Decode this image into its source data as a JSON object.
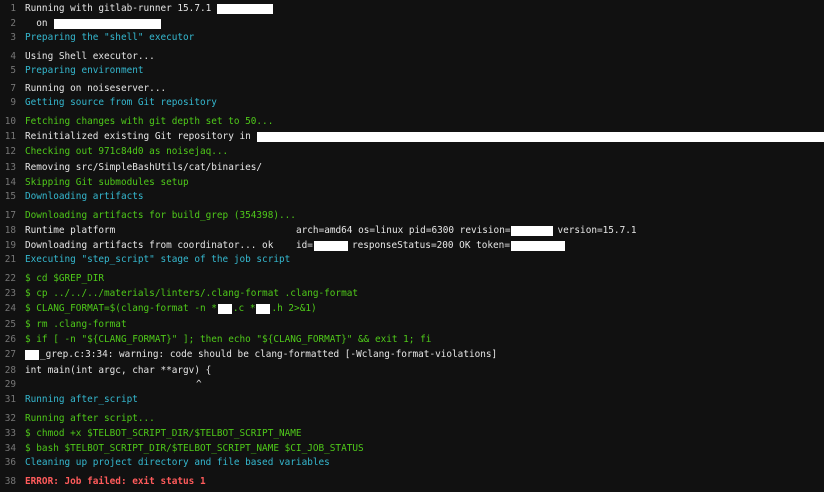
{
  "colors": {
    "background": "#111111",
    "line_number": "#777777",
    "text": "#e6e6e6",
    "section": "#35b8cf",
    "command": "#4fc91a",
    "error": "#ff5b5b",
    "redaction": "#ffffff"
  },
  "log": {
    "l1": "Running with gitlab-runner 15.7.1",
    "l2": "  on",
    "l3": "Preparing the \"shell\" executor",
    "l4": "Using Shell executor...",
    "l5": "Preparing environment",
    "l7": "Running on noiseserver...",
    "l9": "Getting source from Git repository",
    "l10": "Fetching changes with git depth set to 50...",
    "l11": "Reinitialized existing Git repository in",
    "l12": "Checking out 971c84d0 as noisejaq...",
    "l13": "Removing src/SimpleBashUtils/cat/binaries/",
    "l14": "Skipping Git submodules setup",
    "l15": "Downloading artifacts",
    "l17": "Downloading artifacts for build_grep (354398)...",
    "l18a": "Runtime platform",
    "l18b": "arch=amd64 os=linux pid=6300 revision=",
    "l18c": "version=15.7.1",
    "l19a": "Downloading artifacts from coordinator... ok",
    "l19b": "id=",
    "l19c": "responseStatus=200 OK token=",
    "l21": "Executing \"step_script\" stage of the job script",
    "l22": "$ cd $GREP_DIR",
    "l23": "$ cp ../../../materials/linters/.clang-format .clang-format",
    "l24a": "$ CLANG_FORMAT=$(clang-format -n *",
    "l24b": ".c *",
    "l24c": ".h 2>&1)",
    "l25": "$ rm .clang-format",
    "l26": "$ if [ -n \"${CLANG_FORMAT}\" ]; then echo \"${CLANG_FORMAT}\" && exit 1; fi",
    "l27": "_grep.c:3:34: warning: code should be clang-formatted [-Wclang-format-violations]",
    "l28": "int main(int argc, char **argv) {",
    "l29": "^",
    "l31": "Running after_script",
    "l32": "Running after script...",
    "l33": "$ chmod +x $TELBOT_SCRIPT_DIR/$TELBOT_SCRIPT_NAME",
    "l34": "$ bash $TELBOT_SCRIPT_DIR/$TELBOT_SCRIPT_NAME $CI_JOB_STATUS",
    "l36": "Cleaning up project directory and file based variables",
    "l38": "ERROR: Job failed: exit status 1"
  }
}
